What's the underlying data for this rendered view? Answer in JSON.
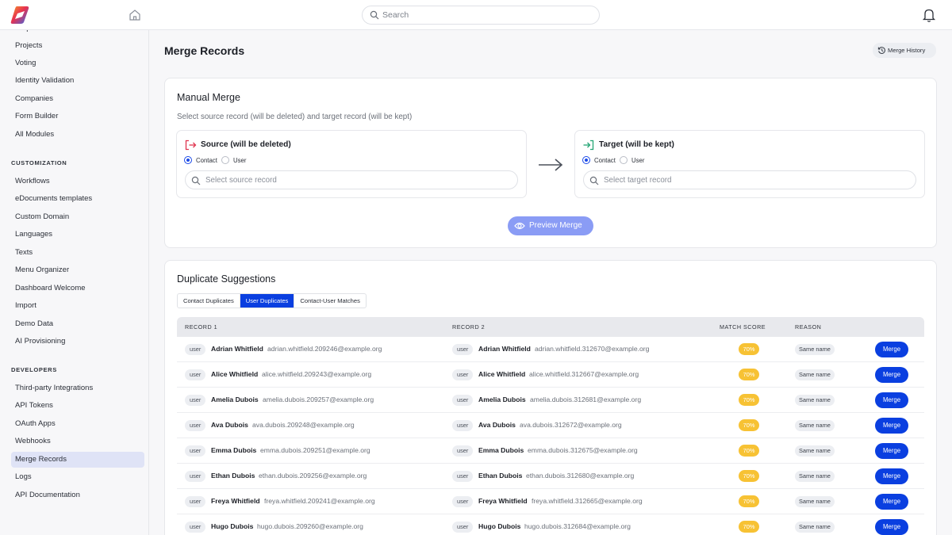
{
  "colors": {
    "accent": "#0a3fe0",
    "accent_soft": "#8a9cf5",
    "score": "#f7c234",
    "source": "#e0344f",
    "target": "#23a574"
  },
  "topbar": {
    "search_placeholder": "Search",
    "logo_icon": "brand-logo",
    "home_icon": "home-icon",
    "bell_icon": "bell-icon"
  },
  "sidebar": {
    "top_items": [
      {
        "label": "Helpdesk"
      },
      {
        "label": "Projects"
      },
      {
        "label": "Voting"
      },
      {
        "label": "Identity Validation"
      },
      {
        "label": "Companies"
      },
      {
        "label": "Form Builder"
      },
      {
        "label": "All Modules"
      }
    ],
    "customization_heading": "CUSTOMIZATION",
    "customization_items": [
      {
        "label": "Workflows"
      },
      {
        "label": "eDocuments templates"
      },
      {
        "label": "Custom Domain"
      },
      {
        "label": "Languages"
      },
      {
        "label": "Texts"
      },
      {
        "label": "Menu Organizer"
      },
      {
        "label": "Dashboard Welcome"
      },
      {
        "label": "Import"
      },
      {
        "label": "Demo Data"
      },
      {
        "label": "AI Provisioning"
      }
    ],
    "developers_heading": "DEVELOPERS",
    "developers_items": [
      {
        "label": "Third-party Integrations"
      },
      {
        "label": "API Tokens"
      },
      {
        "label": "OAuth Apps"
      },
      {
        "label": "Webhooks"
      },
      {
        "label": "Merge Records"
      },
      {
        "label": "Logs"
      },
      {
        "label": "API Documentation"
      }
    ],
    "active": "Merge Records"
  },
  "page": {
    "title": "Merge Records",
    "history_label": "Merge History"
  },
  "manual": {
    "title": "Manual Merge",
    "subtitle": "Select source record (will be deleted) and target record (will be kept)",
    "source": {
      "title": "Source (will be deleted)",
      "opt_contact": "Contact",
      "opt_user": "User",
      "selected": "Contact",
      "placeholder": "Select source record"
    },
    "target": {
      "title": "Target (will be kept)",
      "opt_contact": "Contact",
      "opt_user": "User",
      "selected": "Contact",
      "placeholder": "Select target record"
    },
    "preview_label": "Preview Merge"
  },
  "duplicates": {
    "title": "Duplicate Suggestions",
    "tabs": [
      "Contact Duplicates",
      "User Duplicates",
      "Contact-User Matches"
    ],
    "active_tab": "User Duplicates",
    "headers": {
      "record1": "RECORD 1",
      "record2": "RECORD 2",
      "score": "MATCH SCORE",
      "reason": "REASON"
    },
    "rows": [
      {
        "type1": "user",
        "name1": "Adrian Whitfield",
        "email1": "adrian.whitfield.209246@example.org",
        "type2": "user",
        "name2": "Adrian Whitfield",
        "email2": "adrian.whitfield.312670@example.org",
        "score": "70%",
        "reason": "Same name",
        "action": "Merge"
      },
      {
        "type1": "user",
        "name1": "Alice Whitfield",
        "email1": "alice.whitfield.209243@example.org",
        "type2": "user",
        "name2": "Alice Whitfield",
        "email2": "alice.whitfield.312667@example.org",
        "score": "70%",
        "reason": "Same name",
        "action": "Merge"
      },
      {
        "type1": "user",
        "name1": "Amelia Dubois",
        "email1": "amelia.dubois.209257@example.org",
        "type2": "user",
        "name2": "Amelia Dubois",
        "email2": "amelia.dubois.312681@example.org",
        "score": "70%",
        "reason": "Same name",
        "action": "Merge"
      },
      {
        "type1": "user",
        "name1": "Ava Dubois",
        "email1": "ava.dubois.209248@example.org",
        "type2": "user",
        "name2": "Ava Dubois",
        "email2": "ava.dubois.312672@example.org",
        "score": "70%",
        "reason": "Same name",
        "action": "Merge"
      },
      {
        "type1": "user",
        "name1": "Emma Dubois",
        "email1": "emma.dubois.209251@example.org",
        "type2": "user",
        "name2": "Emma Dubois",
        "email2": "emma.dubois.312675@example.org",
        "score": "70%",
        "reason": "Same name",
        "action": "Merge"
      },
      {
        "type1": "user",
        "name1": "Ethan Dubois",
        "email1": "ethan.dubois.209256@example.org",
        "type2": "user",
        "name2": "Ethan Dubois",
        "email2": "ethan.dubois.312680@example.org",
        "score": "70%",
        "reason": "Same name",
        "action": "Merge"
      },
      {
        "type1": "user",
        "name1": "Freya Whitfield",
        "email1": "freya.whitfield.209241@example.org",
        "type2": "user",
        "name2": "Freya Whitfield",
        "email2": "freya.whitfield.312665@example.org",
        "score": "70%",
        "reason": "Same name",
        "action": "Merge"
      },
      {
        "type1": "user",
        "name1": "Hugo Dubois",
        "email1": "hugo.dubois.209260@example.org",
        "type2": "user",
        "name2": "Hugo Dubois",
        "email2": "hugo.dubois.312684@example.org",
        "score": "70%",
        "reason": "Same name",
        "action": "Merge"
      }
    ]
  }
}
